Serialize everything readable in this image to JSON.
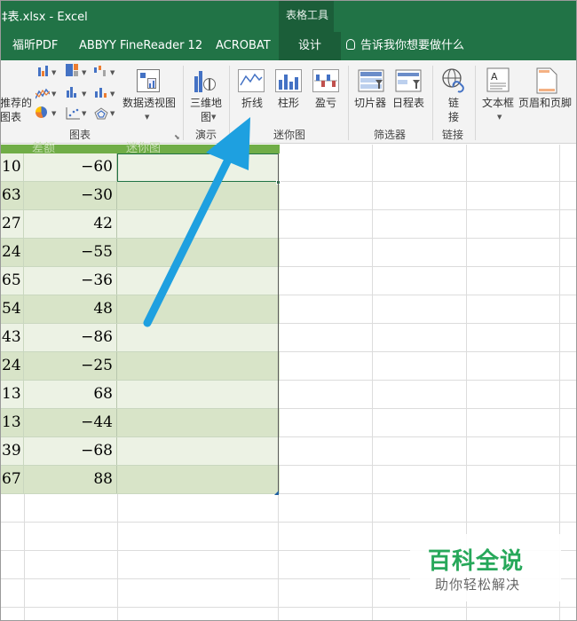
{
  "window": {
    "title": "‡表.xlsx  -  Excel",
    "context_tab_title": "表格工具"
  },
  "tabs": [
    {
      "label": "福昕PDF"
    },
    {
      "label": "ABBYY FineReader 12"
    },
    {
      "label": "ACROBAT"
    },
    {
      "label": "设计",
      "active": true
    }
  ],
  "tell_me": "告诉我你想要做什么",
  "ribbon": {
    "recommended_chart": "推荐的\n图表",
    "pivot_chart": "数据透视图",
    "map_3d": "三维地\n图",
    "sparkline_line": "折线",
    "sparkline_column": "柱形",
    "sparkline_winloss": "盈亏",
    "slicer": "切片器",
    "timeline": "日程表",
    "link": "链\n接",
    "textbox": "文本框",
    "header_footer": "页眉和页脚",
    "groups": {
      "charts": "图表",
      "tours": "演示",
      "sparklines": "迷你图",
      "filters": "筛选器",
      "links": "链接"
    }
  },
  "table": {
    "headers": [
      "...",
      "差额",
      "迷你图"
    ],
    "rows": [
      {
        "a": "10",
        "b": "−60"
      },
      {
        "a": "63",
        "b": "−30"
      },
      {
        "a": "27",
        "b": "42"
      },
      {
        "a": "24",
        "b": "−55"
      },
      {
        "a": "65",
        "b": "−36"
      },
      {
        "a": "54",
        "b": "48"
      },
      {
        "a": "43",
        "b": "−86"
      },
      {
        "a": "24",
        "b": "−25"
      },
      {
        "a": "13",
        "b": "68"
      },
      {
        "a": "13",
        "b": "−44"
      },
      {
        "a": "39",
        "b": "−68"
      },
      {
        "a": "67",
        "b": "88"
      }
    ]
  },
  "watermark": {
    "title": "百科全说",
    "subtitle": "助你轻松解决"
  },
  "colors": {
    "excel_green": "#217346",
    "header_green": "#70ad47",
    "band_dark": "#d8e4c8",
    "band_light": "#ecf2e4",
    "arrow": "#1ea0e0"
  }
}
